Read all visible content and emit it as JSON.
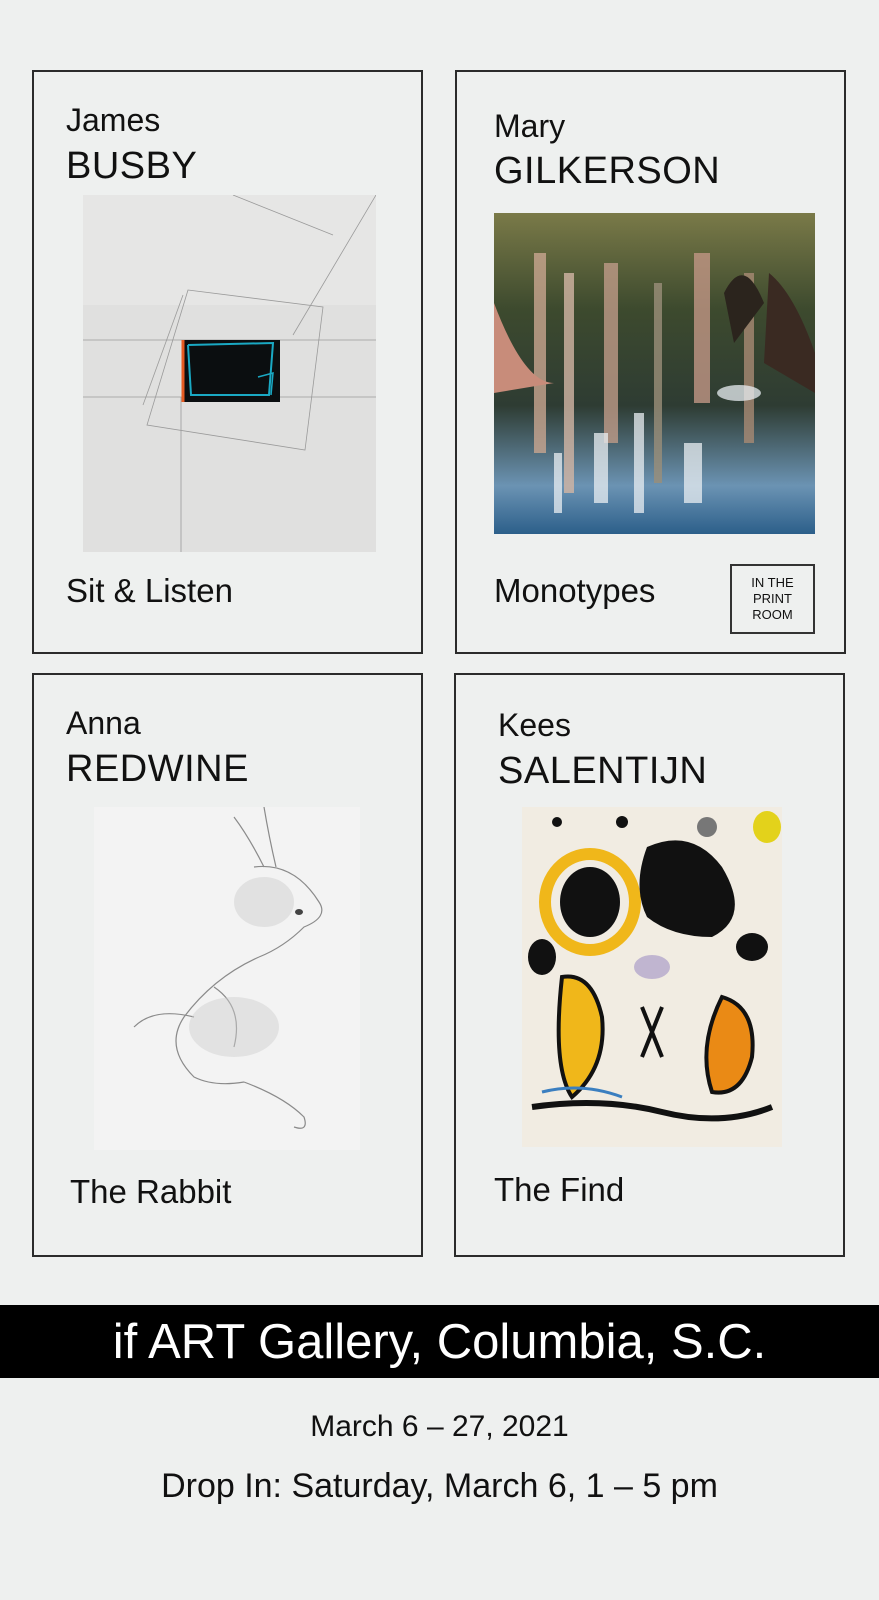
{
  "artists": [
    {
      "first": "James",
      "last": "BUSBY",
      "title": "Sit & Listen"
    },
    {
      "first": "Mary",
      "last": "GILKERSON",
      "title": "Monotypes",
      "note": "IN THE PRINT ROOM"
    },
    {
      "first": "Anna",
      "last": "REDWINE",
      "title": "The Rabbit"
    },
    {
      "first": "Kees",
      "last": "SALENTIJN",
      "title": "The Find"
    }
  ],
  "gallery": "if ART Gallery, Columbia, S.C.",
  "dates": "March 6 – 27, 2021",
  "drop_in": "Drop In: Saturday, March 6, 1 – 5 pm",
  "colors": {
    "background": "#eef0ef",
    "banner": "#000000",
    "banner_text": "#ffffff"
  }
}
